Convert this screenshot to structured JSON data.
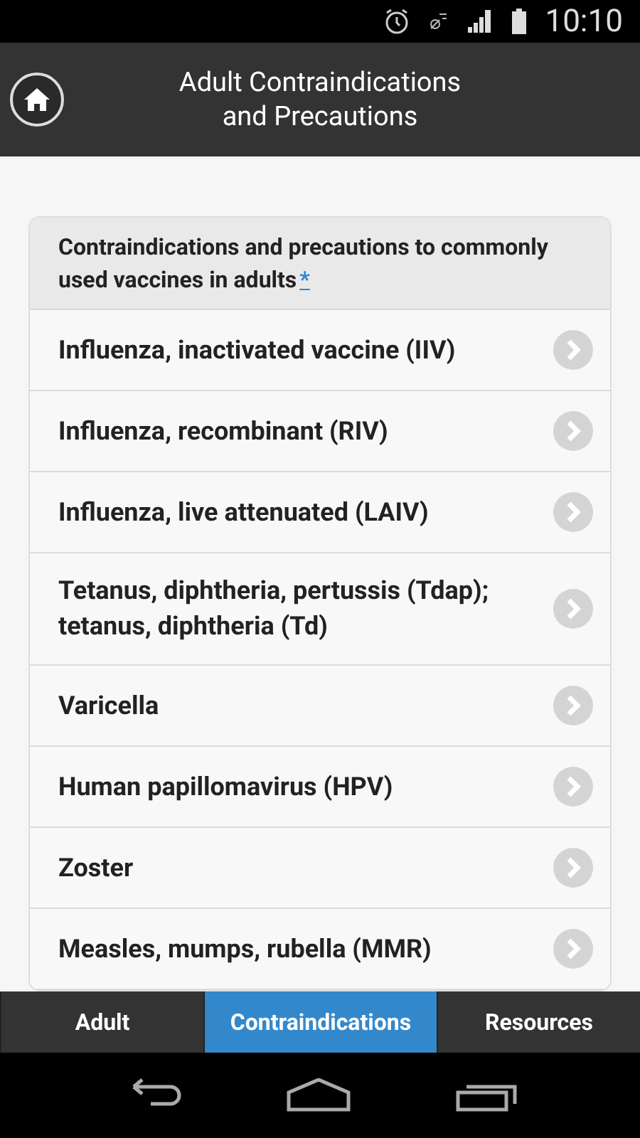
{
  "status_bar": {
    "time": "10:10"
  },
  "header": {
    "title": "Adult Contraindications and Precautions"
  },
  "card": {
    "heading": "Contraindications and precautions to commonly used vaccines in adults",
    "footnote_link": "*"
  },
  "items": [
    {
      "label": "Influenza, inactivated vaccine (IIV)"
    },
    {
      "label": "Influenza, recombinant (RIV)"
    },
    {
      "label": "Influenza, live attenuated (LAIV)"
    },
    {
      "label": "Tetanus, diphtheria, pertussis (Tdap); tetanus, diphtheria (Td)"
    },
    {
      "label": "Varicella"
    },
    {
      "label": "Human papillomavirus (HPV)"
    },
    {
      "label": "Zoster"
    },
    {
      "label": "Measles, mumps, rubella (MMR)"
    }
  ],
  "tabs": [
    {
      "label": "Adult",
      "selected": false
    },
    {
      "label": "Contraindications",
      "selected": true
    },
    {
      "label": "Resources",
      "selected": false
    }
  ]
}
